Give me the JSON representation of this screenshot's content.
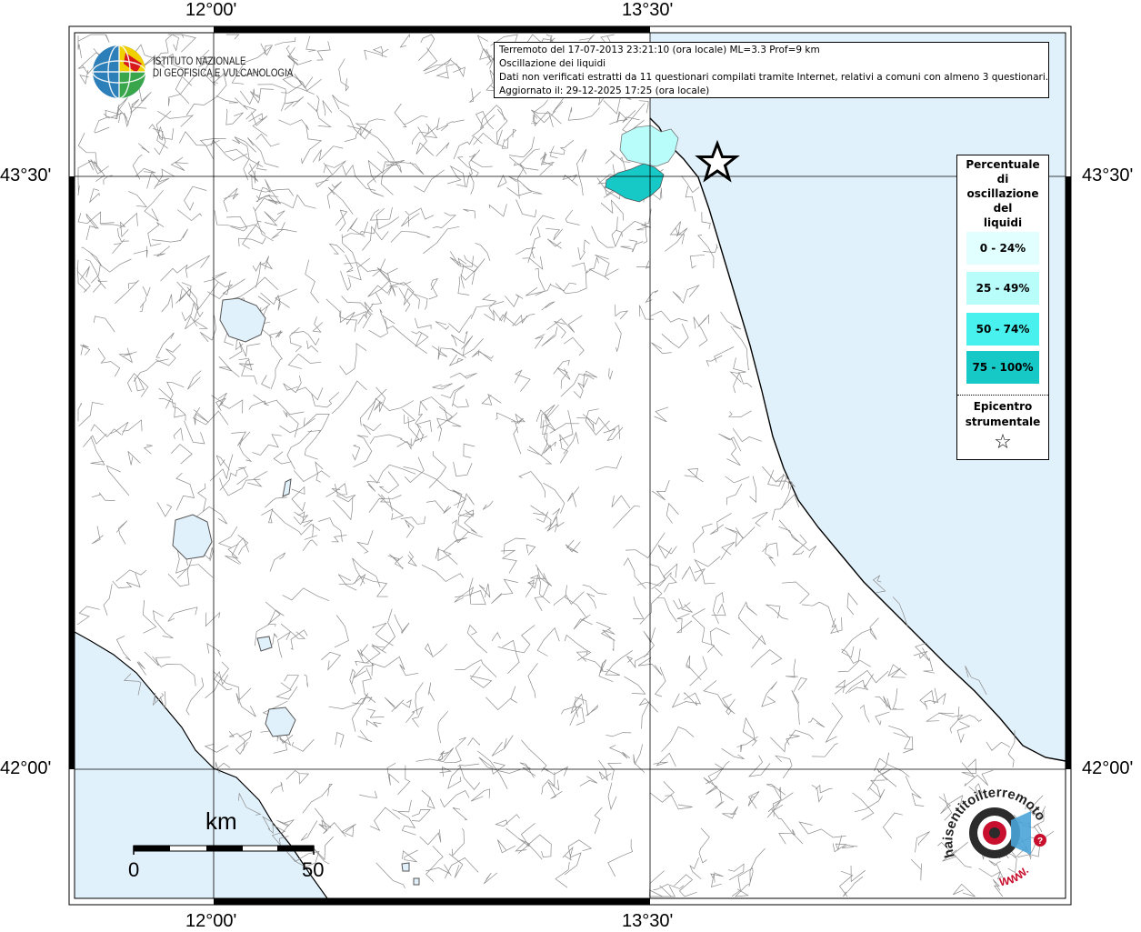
{
  "coords": {
    "top_left": "12°00'",
    "top_right": "13°30'",
    "bottom_left": "12°00'",
    "bottom_right": "13°30'",
    "left_upper": "43°30'",
    "left_lower": "42°00'",
    "right_upper": "43°30'",
    "right_lower": "42°00'"
  },
  "info": {
    "line1": "Terremoto del 17-07-2013 23:21:10 (ora locale) ML=3.3 Prof=9 km",
    "line2": "Oscillazione dei liquidi",
    "line3": "Dati non verificati estratti da 11 questionari compilati tramite Internet, relativi a comuni con almeno 3 questionari.",
    "line4": "Aggiornato il: 29-12-2025 17:25 (ora locale)"
  },
  "institute_logo": {
    "line1": "ISTITUTO NAZIONALE",
    "line2": "DI GEOFISICA E VULCANOLOGIA"
  },
  "legend": {
    "title": [
      "Percentuale",
      "di",
      "oscillazione",
      "del",
      "liquidi"
    ],
    "classes": [
      {
        "label": "0 - 24%",
        "color": "#e0fffe"
      },
      {
        "label": "25 - 49%",
        "color": "#b9fdfa"
      },
      {
        "label": "50 - 74%",
        "color": "#48f1ed"
      },
      {
        "label": "75 - 100%",
        "color": "#17c9c6"
      }
    ],
    "epicenter_title": [
      "Epicentro",
      "strumentale"
    ],
    "epicenter_symbol": "☆"
  },
  "scale": {
    "unit": "km",
    "min": "0",
    "max": "50"
  },
  "haisentito_logo": {
    "text": "haisentitoilterremoto.it",
    "url_text": "WWW."
  },
  "colors": {
    "sea": "#e1f1fb",
    "land": "#ffffff",
    "border": "#000000",
    "municipality_lines": "#8c8c8c"
  }
}
